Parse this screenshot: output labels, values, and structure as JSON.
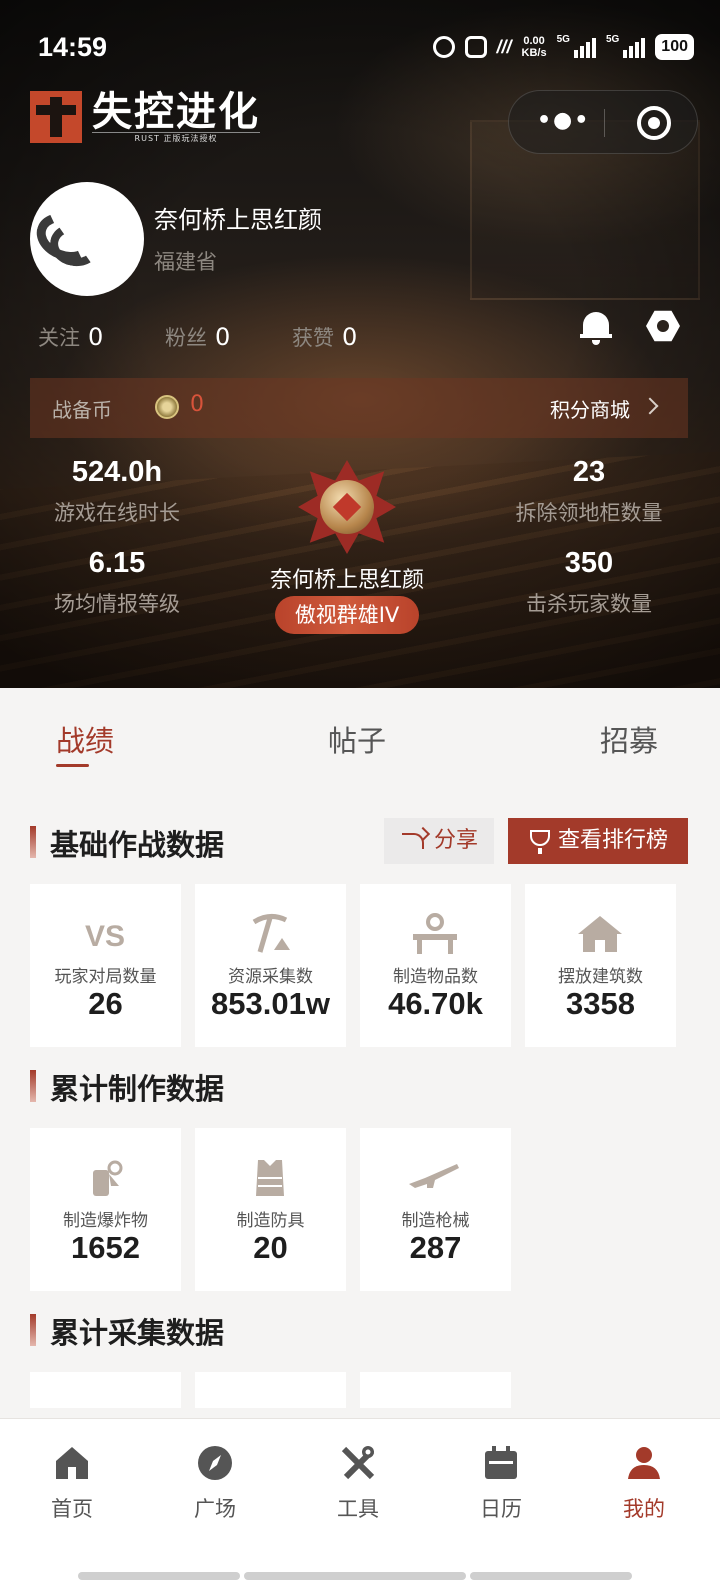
{
  "status_bar": {
    "time": "14:59",
    "net_speed_top": "0.00",
    "net_speed_bottom": "KB/s",
    "sig1": "5G",
    "sig2": "5G",
    "battery": "100"
  },
  "header": {
    "logo_title": "失控进化",
    "logo_subtitle": "RUST 正版玩法授权"
  },
  "profile": {
    "name": "奈何桥上思红颜",
    "province": "福建省"
  },
  "social": {
    "follow_label": "关注",
    "follow_count": "0",
    "fans_label": "粉丝",
    "fans_count": "0",
    "likes_label": "获赞",
    "likes_count": "0"
  },
  "coins": {
    "label": "战备币",
    "value": "0",
    "mall_label": "积分商城"
  },
  "hero_stats": {
    "online_hours": "524.0h",
    "online_hours_label": "游戏在线时长",
    "intel_level": "6.15",
    "intel_level_label": "场均情报等级",
    "cabinets": "23",
    "cabinets_label": "拆除领地柜数量",
    "kills": "350",
    "kills_label": "击杀玩家数量",
    "rank_player": "奈何桥上思红颜",
    "rank_title": "傲视群雄IV"
  },
  "tabs": [
    {
      "label": "战绩"
    },
    {
      "label": "帖子"
    },
    {
      "label": "招募"
    }
  ],
  "sections": {
    "basic": {
      "title": "基础作战数据",
      "share_label": "分享",
      "ranking_label": "查看排行榜",
      "cards": [
        {
          "label": "玩家对局数量",
          "value": "26",
          "icon": "vs-icon"
        },
        {
          "label": "资源采集数",
          "value": "853.01w",
          "icon": "pickaxe-icon"
        },
        {
          "label": "制造物品数",
          "value": "46.70k",
          "icon": "workbench-icon"
        },
        {
          "label": "摆放建筑数",
          "value": "3358",
          "icon": "house-icon"
        }
      ]
    },
    "crafting": {
      "title": "累计制作数据",
      "cards": [
        {
          "label": "制造爆炸物",
          "value": "1652",
          "icon": "explosive-icon"
        },
        {
          "label": "制造防具",
          "value": "20",
          "icon": "armor-vest-icon"
        },
        {
          "label": "制造枪械",
          "value": "287",
          "icon": "rifle-icon"
        }
      ]
    },
    "gathering": {
      "title": "累计采集数据"
    }
  },
  "bottom_nav": [
    {
      "label": "首页",
      "icon": "home-icon"
    },
    {
      "label": "广场",
      "icon": "compass-icon"
    },
    {
      "label": "工具",
      "icon": "tools-icon"
    },
    {
      "label": "日历",
      "icon": "calendar-icon"
    },
    {
      "label": "我的",
      "icon": "profile-icon",
      "active": true
    }
  ],
  "colors": {
    "accent": "#a33a2a",
    "coin_value": "#d8533a"
  }
}
